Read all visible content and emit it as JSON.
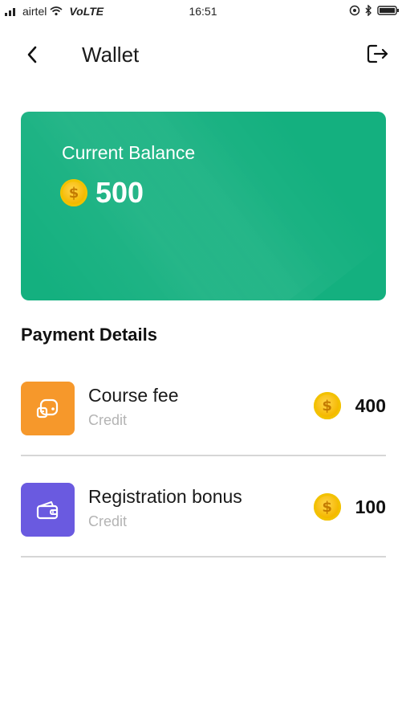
{
  "status_bar": {
    "carrier": "airtel",
    "network": "VoLTE",
    "time": "16:51"
  },
  "header": {
    "title": "Wallet",
    "back_icon": "chevron-left-icon",
    "logout_icon": "logout-icon"
  },
  "balance_card": {
    "label": "Current Balance",
    "value": "500",
    "coin_symbol": "$",
    "color": "#14b07f"
  },
  "payment_details": {
    "title": "Payment Details",
    "items": [
      {
        "title": "Course fee",
        "subtitle": "Credit",
        "amount": "400",
        "icon": "wallet-coins-icon",
        "icon_color": "#f6982b"
      },
      {
        "title": "Registration bonus",
        "subtitle": "Credit",
        "amount": "100",
        "icon": "wallet-icon",
        "icon_color": "#6a5ae0"
      }
    ]
  }
}
